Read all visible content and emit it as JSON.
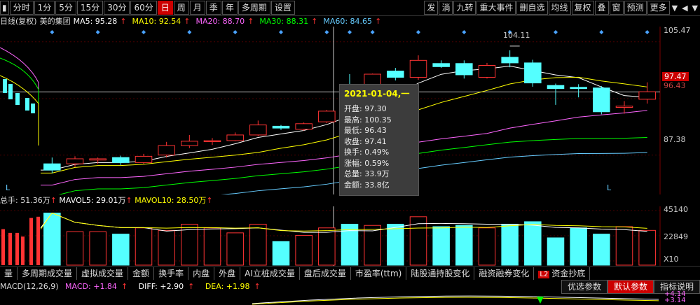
{
  "toolbar": {
    "periods": [
      {
        "label": "分时"
      },
      {
        "label": "1分"
      },
      {
        "label": "5分"
      },
      {
        "label": "15分"
      },
      {
        "label": "30分"
      },
      {
        "label": "60分"
      },
      {
        "label": "日",
        "active": true
      },
      {
        "label": "周"
      },
      {
        "label": "月"
      },
      {
        "label": "季"
      },
      {
        "label": "年"
      },
      {
        "label": "多周期"
      },
      {
        "label": "设置"
      }
    ],
    "right": [
      "发",
      "淌",
      "九转",
      "重大事件",
      "删自选",
      "均线",
      "复权",
      "叠",
      "窗",
      "预测",
      "更多"
    ]
  },
  "legend": {
    "title": "日线(复权)",
    "stock": "美的集团",
    "ma5": "MA5: 95.28",
    "ma10": "MA10: 92.54",
    "ma20": "MA20: 88.70",
    "ma30": "MA30: 88.31",
    "ma60": "MA60: 84.65",
    "arrow": "↑"
  },
  "colors": {
    "ma5": "#ffffff",
    "ma10": "#ffff00",
    "ma20": "#ff66ff",
    "ma30": "#00ff00",
    "ma60": "#66ccff",
    "up": "#ff3333",
    "down": "#54ffff"
  },
  "price_axis": {
    "top": "105.47",
    "mid": "87.38",
    "current": "97.47",
    "current2": "96.43",
    "high_marker": "104.11"
  },
  "tooltip": {
    "date": "2021-01-04,一",
    "rows": [
      "开盘: 97.30",
      "最高: 100.35",
      "最低: 96.43",
      "收盘: 97.41",
      "换手: 0.49%",
      "涨幅: 0.59%",
      "总量: 33.9万",
      "金额: 33.8亿"
    ]
  },
  "vol_legend": {
    "hand": "总手: 51.36万",
    "mavol5": "MAVOL5: 29.01万",
    "mavol10": "MAVOL10: 28.50万",
    "arrow": "↑"
  },
  "vol_axis": {
    "top": "45140",
    "mid": "22849",
    "unit": "X10"
  },
  "indicator_tabs": [
    "量",
    "多周期成交量",
    "虚拟成交量",
    "金额",
    "换手率",
    "内盘",
    "外盘",
    "AI立桩成交量",
    "盘后成交量",
    "市盈率(ttm)",
    "陆股通持股变化",
    "融资融券变化",
    "资金抄底"
  ],
  "indicator_tab_badge": "L2",
  "macd_legend": {
    "name": "MACD(12,26,9)",
    "macd": "MACD: +1.84",
    "diff": "DIFF: +2.90",
    "dea": "DEA: +1.98",
    "arrow": "↑"
  },
  "param_tabs": [
    "优选参数",
    "默认参数",
    "指标说明"
  ],
  "macd_axis": {
    "a": "+4.14",
    "b": "+3.14"
  },
  "low_marker": "L",
  "chart_data": {
    "type": "candlestick",
    "candles": [
      {
        "o": 86.0,
        "h": 87.0,
        "l": 84.5,
        "c": 85.0
      },
      {
        "o": 86.0,
        "h": 87.2,
        "l": 85.5,
        "c": 86.8
      },
      {
        "o": 86.6,
        "h": 87.0,
        "l": 86.0,
        "c": 86.8
      },
      {
        "o": 87.0,
        "h": 87.3,
        "l": 85.8,
        "c": 86.2
      },
      {
        "o": 86.2,
        "h": 87.6,
        "l": 86.0,
        "c": 87.2
      },
      {
        "o": 87.4,
        "h": 89.5,
        "l": 87.0,
        "c": 88.9
      },
      {
        "o": 88.9,
        "h": 90.6,
        "l": 88.5,
        "c": 89.6
      },
      {
        "o": 89.6,
        "h": 90.1,
        "l": 89.0,
        "c": 89.7
      },
      {
        "o": 89.7,
        "h": 91.0,
        "l": 89.6,
        "c": 90.6
      },
      {
        "o": 90.6,
        "h": 92.9,
        "l": 90.4,
        "c": 92.2
      },
      {
        "o": 92.0,
        "h": 92.2,
        "l": 91.4,
        "c": 91.7
      },
      {
        "o": 91.5,
        "h": 92.6,
        "l": 91.3,
        "c": 92.4
      },
      {
        "o": 92.7,
        "h": 94.6,
        "l": 92.5,
        "c": 94.4
      },
      {
        "o": 97.4,
        "h": 100.3,
        "l": 96.4,
        "c": 97.3
      },
      {
        "o": 97.4,
        "h": 100.4,
        "l": 96.4,
        "c": 100.3
      },
      {
        "o": 100.8,
        "h": 101.3,
        "l": 99.3,
        "c": 99.8
      },
      {
        "o": 99.8,
        "h": 103.3,
        "l": 99.4,
        "c": 102.5
      },
      {
        "o": 102.0,
        "h": 102.5,
        "l": 101.3,
        "c": 101.5
      },
      {
        "o": 102.0,
        "h": 102.5,
        "l": 99.6,
        "c": 100.2
      },
      {
        "o": 99.8,
        "h": 102.1,
        "l": 99.6,
        "c": 101.7
      },
      {
        "o": 103.0,
        "h": 104.1,
        "l": 101.4,
        "c": 102.1
      },
      {
        "o": 102.1,
        "h": 102.6,
        "l": 98.3,
        "c": 98.9
      },
      {
        "o": 98.5,
        "h": 98.8,
        "l": 95.4,
        "c": 98.0
      },
      {
        "o": 98.2,
        "h": 98.7,
        "l": 96.6,
        "c": 98.0
      },
      {
        "o": 98.1,
        "h": 98.4,
        "l": 93.9,
        "c": 94.3
      },
      {
        "o": 95.0,
        "h": 96.0,
        "l": 94.0,
        "c": 95.2
      },
      {
        "o": 96.3,
        "h": 99.0,
        "l": 95.6,
        "c": 97.5
      }
    ],
    "volumes": [
      420,
      270,
      270,
      250,
      300,
      280,
      330,
      300,
      260,
      330,
      190,
      240,
      300,
      330,
      320,
      330,
      390,
      310,
      320,
      300,
      330,
      350,
      220,
      300,
      250,
      310,
      280
    ],
    "ylim": [
      82.0,
      107.0
    ]
  }
}
